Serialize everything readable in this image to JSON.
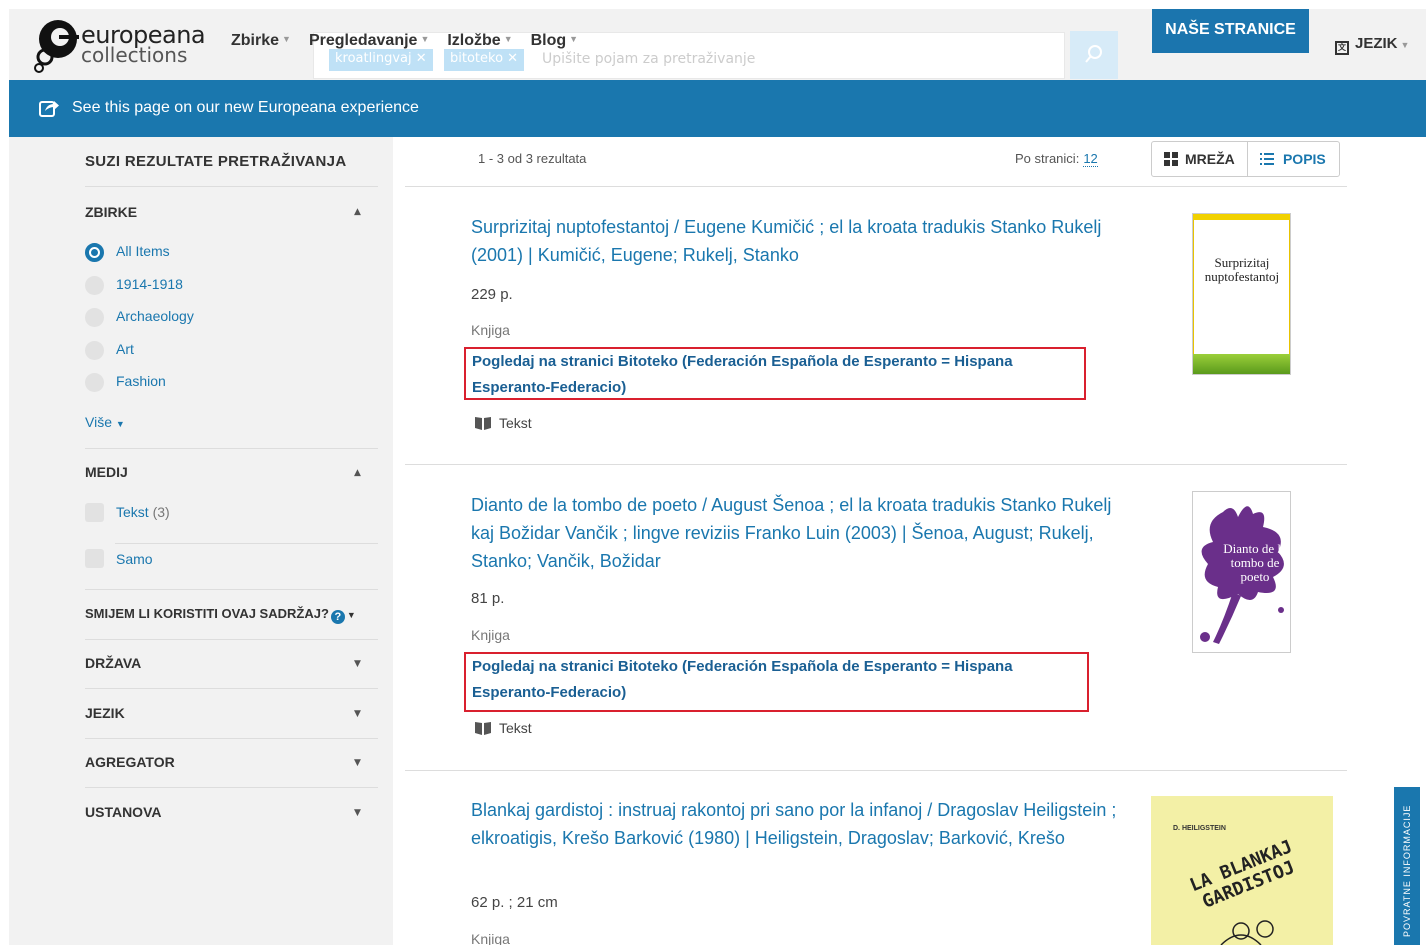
{
  "header": {
    "logo_line1": "europeana",
    "logo_line2": "collections",
    "nav": [
      "Zbirke",
      "Pregledavanje",
      "Izložbe",
      "Blog"
    ],
    "search_pills": [
      "kroatlingvaj",
      "bitoteko"
    ],
    "search_placeholder": "Upišite pojam za pretraživanje",
    "cta_label": "NAŠE STRANICE",
    "language_label": "JEZIK"
  },
  "banner": {
    "text": "See this page on our new Europeana experience"
  },
  "sidebar": {
    "title": "SUZI REZULTATE PRETRAŽIVANJA",
    "collections_heading": "ZBIRKE",
    "collections": [
      "All Items",
      "1914-1918",
      "Archaeology",
      "Art",
      "Fashion"
    ],
    "collections_selected": "All Items",
    "more_label": "Više",
    "media_heading": "MEDIJ",
    "media_text_label": "Tekst",
    "media_text_count": "(3)",
    "media_only_label": "Samo",
    "rights_heading": "SMIJEM LI KORISTITI OVAJ SADRŽAJ?",
    "country_heading": "DRŽAVA",
    "language_heading": "JEZIK",
    "aggregator_heading": "AGREGATOR",
    "institution_heading": "USTANOVA"
  },
  "results_bar": {
    "count_text": "1 - 3 od 3 rezultata",
    "per_page_label": "Po stranici:",
    "per_page_value": "12",
    "grid_label": "MREŽA",
    "list_label": "POPIS"
  },
  "results": [
    {
      "title": "Surprizitaj nuptofestantoj / Eugene Kumičić ; el la kroata tradukis Stanko Rukelj (2001) | Kumičić, Eugene; Rukelj, Stanko",
      "extent": "229 p.",
      "type": "Knjiga",
      "provider": "Pogledaj na stranici Bitoteko (Federación Española de Esperanto = Hispana Esperanto-Federacio)",
      "media": "Tekst",
      "thumb_title": "Surprizitaj nuptofestantoj"
    },
    {
      "title": "Dianto de la tombo de poeto / August Šenoa ; el la kroata tradukis Stanko Rukelj kaj Božidar Vančik ; lingve reviziis Franko Luin (2003) | Šenoa, August; Rukelj, Stanko; Vančik, Božidar",
      "extent": "81 p.",
      "type": "Knjiga",
      "provider": "Pogledaj na stranici Bitoteko (Federación Española de Esperanto = Hispana Esperanto-Federacio)",
      "media": "Tekst",
      "thumb_title": "Dianto de la tombo de poeto"
    },
    {
      "title": "Blankaj gardistoj : instruaj rakontoj pri sano por la infanoj / Dragoslav Heiligstein ; elkroatigis, Krešo Barković (1980) | Heiligstein, Dragoslav; Barković, Krešo",
      "extent": "62 p. ; 21 cm",
      "type": "Knjiga",
      "thumb_title": "LA BLANKAJ GARDISTOJ",
      "thumb_author": "D. HEILIGSTEIN"
    }
  ],
  "feedback_label": "POVRATNE INFORMACIJE",
  "colors": {
    "brand_blue": "#1a77ae",
    "highlight_red": "#d9202e"
  }
}
